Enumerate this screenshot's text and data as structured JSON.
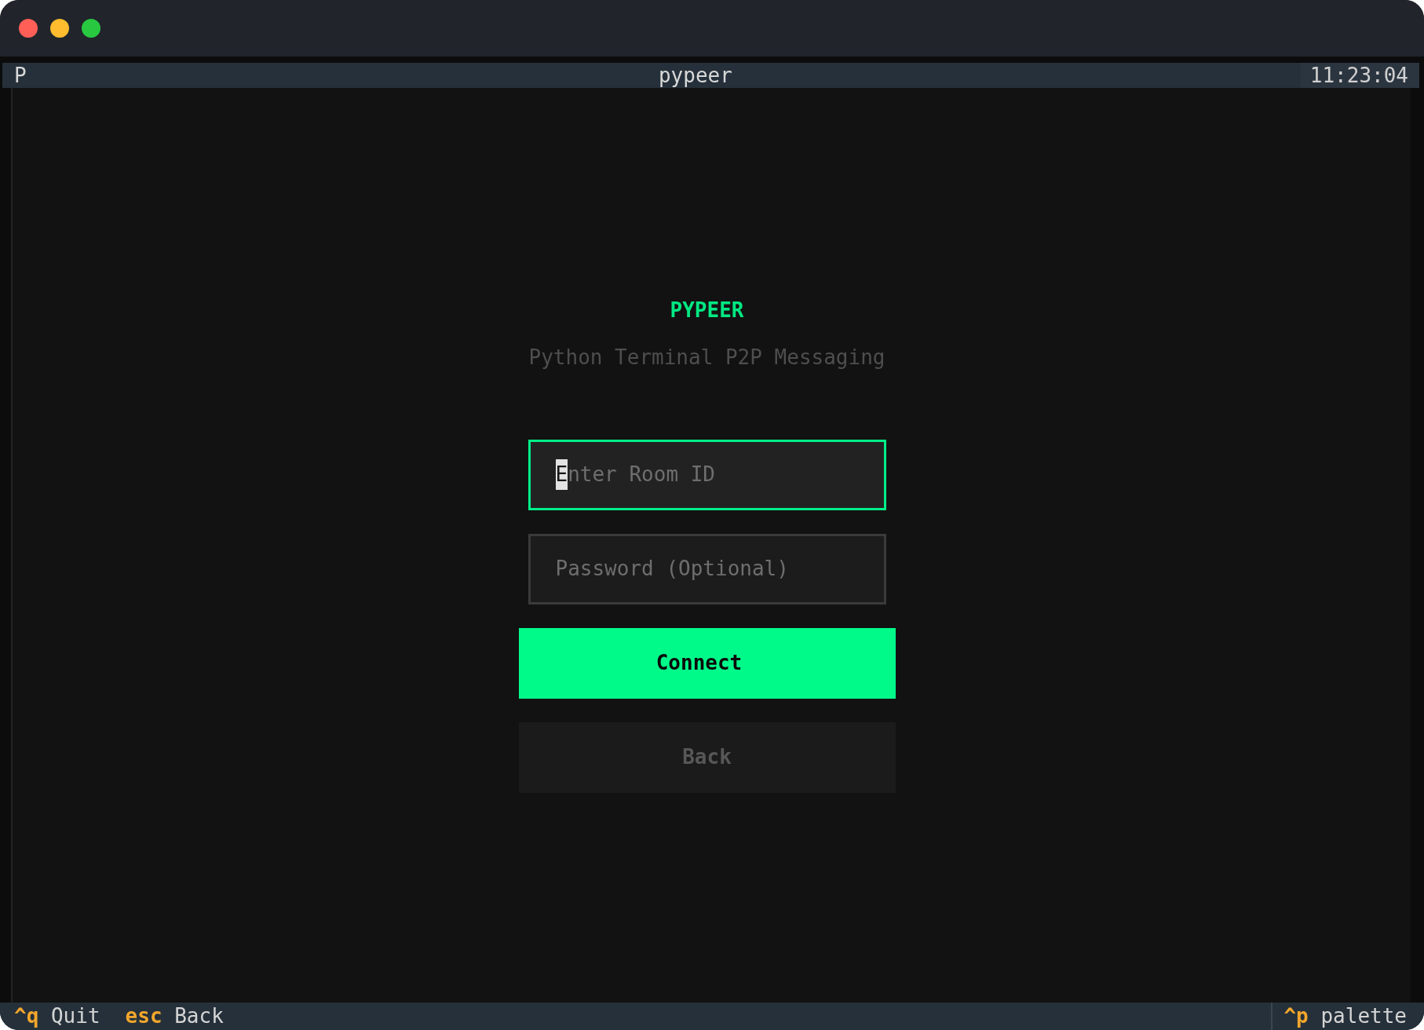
{
  "header": {
    "icon": "P",
    "title": "pypeer",
    "clock": "11:23:04"
  },
  "app": {
    "title": "PYPEER",
    "subtitle": "Python Terminal P2P Messaging"
  },
  "fields": [
    {
      "placeholder": "Enter Room ID",
      "focused": true
    },
    {
      "placeholder": "Password (Optional)",
      "focused": false
    }
  ],
  "buttons": [
    {
      "label": "Connect",
      "kind": "primary"
    },
    {
      "label": "Back",
      "kind": "default"
    }
  ],
  "footer": {
    "bindings": [
      {
        "key": "^q",
        "action": "Quit"
      },
      {
        "key": "esc",
        "action": "Back"
      }
    ],
    "palette_binding": {
      "key": "^p",
      "action": "palette"
    }
  }
}
